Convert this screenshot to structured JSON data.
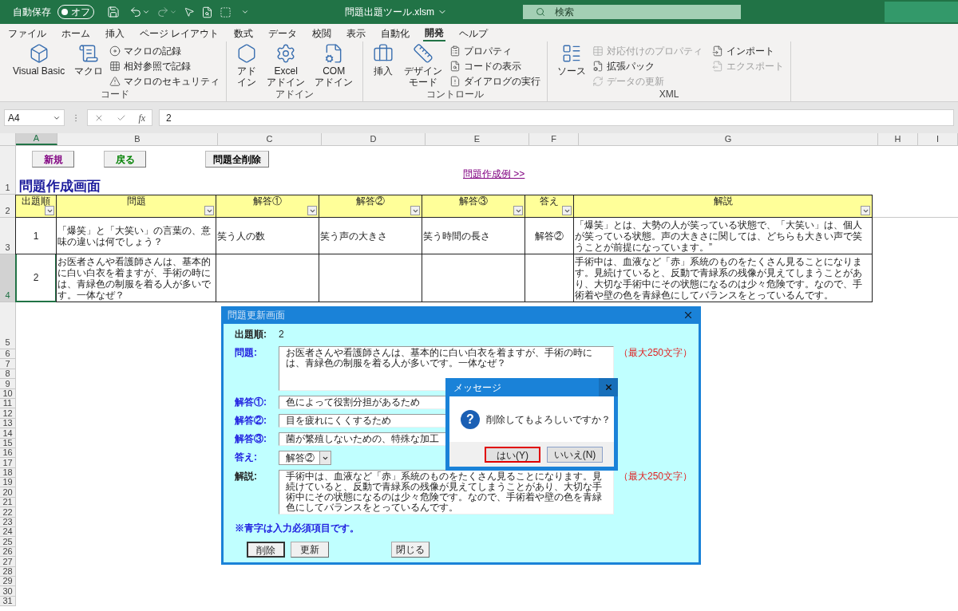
{
  "title_bar": {
    "autosave_label": "自動保存",
    "autosave_toggle": {
      "label": "オフ",
      "on": false
    },
    "filename": "問題出題ツール.xlsm",
    "search_placeholder": "検索"
  },
  "ribbon_tabs": [
    {
      "label": "ファイル",
      "selected": false
    },
    {
      "label": "ホーム",
      "selected": false
    },
    {
      "label": "挿入",
      "selected": false
    },
    {
      "label": "ページ レイアウト",
      "selected": false
    },
    {
      "label": "数式",
      "selected": false
    },
    {
      "label": "データ",
      "selected": false
    },
    {
      "label": "校閲",
      "selected": false
    },
    {
      "label": "表示",
      "selected": false
    },
    {
      "label": "自動化",
      "selected": false
    },
    {
      "label": "開発",
      "selected": true
    },
    {
      "label": "ヘルプ",
      "selected": false
    }
  ],
  "ribbon_groups": [
    {
      "label": "コード",
      "items": [
        {
          "kind": "large",
          "label": "Visual Basic",
          "disabled": false
        },
        {
          "kind": "large",
          "label": "マクロ",
          "disabled": false
        },
        {
          "kind": "small",
          "label": "マクロの記録",
          "disabled": false
        },
        {
          "kind": "small",
          "label": "相対参照で記録",
          "disabled": false
        },
        {
          "kind": "small",
          "label": "マクロのセキュリティ",
          "disabled": false
        }
      ]
    },
    {
      "label": "アドイン",
      "items": [
        {
          "kind": "large",
          "label": "アドイン",
          "disabled": false
        },
        {
          "kind": "large",
          "label": "Excel\nアドイン",
          "disabled": false
        },
        {
          "kind": "large",
          "label": "COM\nアドイン",
          "disabled": false
        }
      ]
    },
    {
      "label": "コントロール",
      "items": [
        {
          "kind": "large",
          "label": "挿入",
          "disabled": false
        },
        {
          "kind": "large",
          "label": "デザインモード",
          "disabled": false
        },
        {
          "kind": "small",
          "label": "プロパティ",
          "disabled": false
        },
        {
          "kind": "small",
          "label": "コードの表示",
          "disabled": false
        },
        {
          "kind": "small",
          "label": "ダイアログの実行",
          "disabled": false
        }
      ]
    },
    {
      "label": "XML",
      "items": [
        {
          "kind": "large",
          "label": "ソース",
          "disabled": false
        },
        {
          "kind": "small",
          "label": "対応付けのプロパティ",
          "disabled": true
        },
        {
          "kind": "small",
          "label": "拡張パック",
          "disabled": false
        },
        {
          "kind": "small",
          "label": "データの更新",
          "disabled": true
        },
        {
          "kind": "small",
          "label": "インポート",
          "disabled": false
        },
        {
          "kind": "small",
          "label": "エクスポート",
          "disabled": true
        }
      ]
    }
  ],
  "formula_bar": {
    "name_box": "A4",
    "function_label": "fx",
    "value": "2"
  },
  "columns": [
    {
      "label": "A",
      "selected": true
    },
    {
      "label": "B",
      "selected": false
    },
    {
      "label": "C",
      "selected": false
    },
    {
      "label": "D",
      "selected": false
    },
    {
      "label": "E",
      "selected": false
    },
    {
      "label": "F",
      "selected": false
    },
    {
      "label": "G",
      "selected": false
    },
    {
      "label": "H",
      "selected": false
    },
    {
      "label": "I",
      "selected": false
    }
  ],
  "row_numbers": [
    {
      "label": "1",
      "selected": false
    },
    {
      "label": "2",
      "selected": false
    },
    {
      "label": "3",
      "selected": false
    },
    {
      "label": "4",
      "selected": true
    },
    {
      "label": "5",
      "selected": false
    },
    {
      "label": "6",
      "selected": false
    },
    {
      "label": "7",
      "selected": false
    },
    {
      "label": "8",
      "selected": false
    },
    {
      "label": "9",
      "selected": false
    },
    {
      "label": "10",
      "selected": false
    },
    {
      "label": "11",
      "selected": false
    },
    {
      "label": "12",
      "selected": false
    },
    {
      "label": "13",
      "selected": false
    },
    {
      "label": "14",
      "selected": false
    },
    {
      "label": "15",
      "selected": false
    },
    {
      "label": "16",
      "selected": false
    },
    {
      "label": "17",
      "selected": false
    },
    {
      "label": "18",
      "selected": false
    },
    {
      "label": "19",
      "selected": false
    },
    {
      "label": "20",
      "selected": false
    },
    {
      "label": "21",
      "selected": false
    },
    {
      "label": "22",
      "selected": false
    },
    {
      "label": "23",
      "selected": false
    },
    {
      "label": "24",
      "selected": false
    },
    {
      "label": "25",
      "selected": false
    },
    {
      "label": "26",
      "selected": false
    },
    {
      "label": "27",
      "selected": false
    },
    {
      "label": "28",
      "selected": false
    },
    {
      "label": "29",
      "selected": false
    },
    {
      "label": "30",
      "selected": false
    },
    {
      "label": "31",
      "selected": false
    }
  ],
  "sheet_buttons": [
    {
      "label": "新規",
      "color": "#800080"
    },
    {
      "label": "戻る",
      "color": "#008000"
    },
    {
      "label": "問題全削除",
      "color": "#000000"
    }
  ],
  "sheet_link": "問題作成例 >>",
  "sheet_title": "問題作成画面",
  "table_headers": [
    "出題順",
    "問題",
    "解答①",
    "解答②",
    "解答③",
    "答え",
    "解説"
  ],
  "table_rows": [
    {
      "cells": [
        "1",
        "「爆笑」と「大笑い」の言葉の、意味の違いは何でしょう？",
        "笑う人の数",
        "笑う声の大きさ",
        "笑う時間の長さ",
        "解答②",
        "「爆笑」とは、大勢の人が笑っている状態で、「大笑い」は、個人が笑っている状態。声の大きさに関しては、どちらも大きい声で笑うことが前提になっています。”"
      ]
    },
    {
      "cells": [
        "2",
        "お医者さんや看護師さんは、基本的に白い白衣を着ますが、手術の時には、青緑色の制服を着る人が多いです。一体なぜ？",
        "",
        "",
        "",
        "",
        "手術中は、血液など「赤」系統のものをたくさん見ることになります。見続けていると、反動で青緑系の残像が見えてしまうことがあり、大切な手術中にその状態になるのは少々危険です。なので、手術着や壁の色を青緑色にしてバランスをとっているんです。"
      ]
    }
  ],
  "update_dialog": {
    "title": "問題更新画面",
    "number": {
      "label": "出題順:",
      "value": "2"
    },
    "fields": [
      {
        "kind": "textarea",
        "label": "問題:",
        "required": true,
        "value": "お医者さんや看護師さんは、基本的に白い白衣を着ますが、手術の時には、青緑色の制服を着る人が多いです。一体なぜ？",
        "note": "（最大250文字）"
      },
      {
        "kind": "text",
        "label": "解答①:",
        "required": true,
        "value": "色によって役割分担があるため"
      },
      {
        "kind": "text",
        "label": "解答②:",
        "required": true,
        "value": "目を疲れにくくするため"
      },
      {
        "kind": "text",
        "label": "解答③:",
        "required": true,
        "value": "菌が繁殖しないための、特殊な加工"
      },
      {
        "kind": "combo",
        "label": "答え:",
        "required": true,
        "value": "解答②"
      },
      {
        "kind": "textarea",
        "label": "解説:",
        "required": false,
        "value": "手術中は、血液など「赤」系統のものをたくさん見ることになります。見続けていると、反動で青緑系の残像が見えてしまうことがあり、大切な手術中にその状態になるのは少々危険です。なので、手術着や壁の色を青緑色にしてバランスをとっているんです。",
        "note": "（最大250文字）"
      }
    ],
    "required_note": "※青字は入力必須項目です。",
    "buttons": [
      {
        "label": "削除",
        "focused": true
      },
      {
        "label": "更新",
        "focused": false
      },
      {
        "label": "閉じる",
        "focused": false
      }
    ]
  },
  "message_box": {
    "title": "メッセージ",
    "icon_glyph": "?",
    "message": "削除してもよろしいですか？",
    "buttons": [
      {
        "label": "はい(Y)",
        "focused": true
      },
      {
        "label": "いいえ(N)",
        "focused": false
      }
    ]
  }
}
